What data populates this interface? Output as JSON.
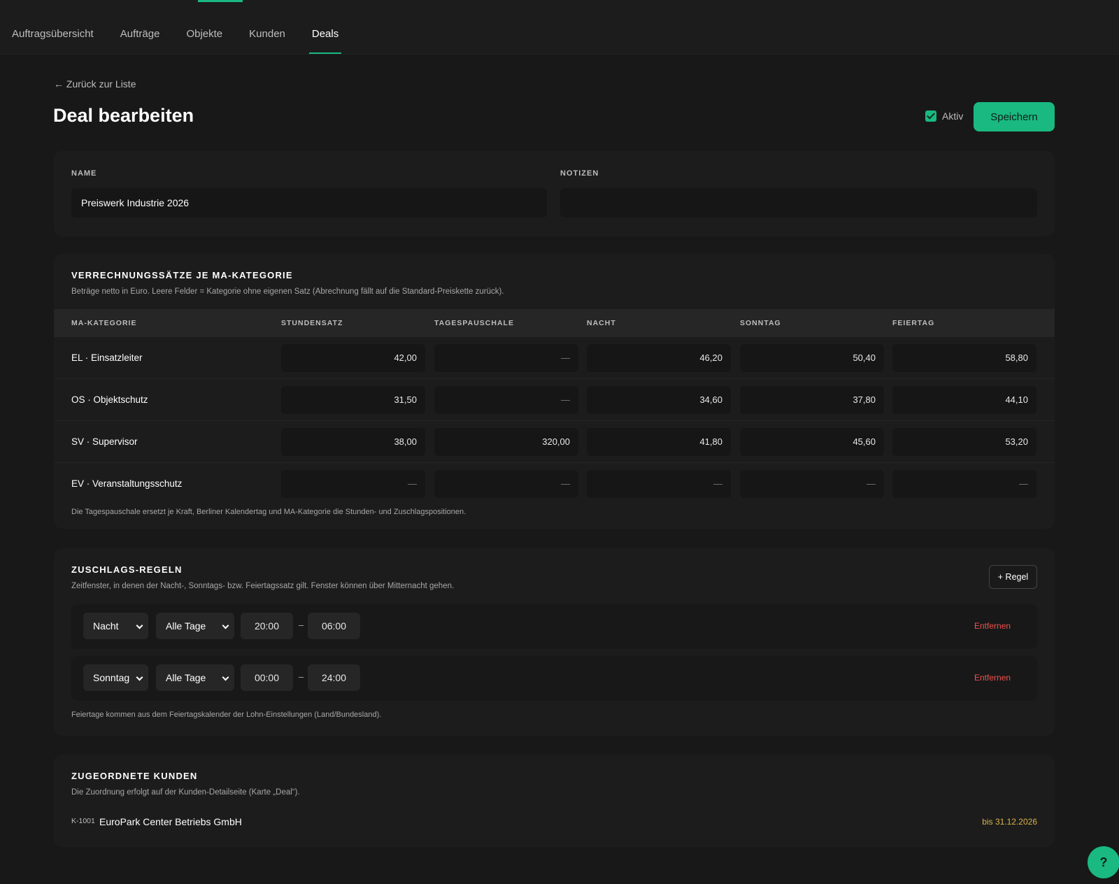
{
  "nav": {
    "items": [
      {
        "label": "Auftragsübersicht"
      },
      {
        "label": "Aufträge"
      },
      {
        "label": "Objekte"
      },
      {
        "label": "Kunden"
      },
      {
        "label": "Deals"
      }
    ],
    "active": "Deals"
  },
  "header": {
    "back_label": "← Zurück zur Liste",
    "title": "Deal bearbeiten",
    "aktiv_label": "Aktiv",
    "aktiv_checked": true,
    "save_label": "Speichern"
  },
  "details": {
    "name_label": "NAME",
    "name_value": "Preiswerk Industrie 2026",
    "notes_label": "NOTIZEN",
    "notes_value": ""
  },
  "rates": {
    "title": "VERRECHNUNGSSÄTZE JE MA-KATEGORIE",
    "subtitle": "Beträge netto in Euro. Leere Felder = Kategorie ohne eigenen Satz (Abrechnung fällt auf die Standard-Preiskette zurück).",
    "columns": [
      "MA-KATEGORIE",
      "STUNDENSATZ",
      "TAGESPAUSCHALE",
      "NACHT",
      "SONNTAG",
      "FEIERTAG"
    ],
    "rows": [
      {
        "category": "EL · Einsatzleiter",
        "values": [
          "42,00",
          "—",
          "46,20",
          "50,40",
          "58,80"
        ]
      },
      {
        "category": "OS · Objektschutz",
        "values": [
          "31,50",
          "—",
          "34,60",
          "37,80",
          "44,10"
        ]
      },
      {
        "category": "SV · Supervisor",
        "values": [
          "38,00",
          "320,00",
          "41,80",
          "45,60",
          "53,20"
        ]
      },
      {
        "category": "EV · Veranstaltungsschutz",
        "values": [
          "—",
          "—",
          "—",
          "—",
          "—"
        ]
      }
    ],
    "footnote": "Die Tagespauschale ersetzt je Kraft, Berliner Kalendertag und MA-Kategorie die Stunden- und Zuschlagspositionen."
  },
  "rules": {
    "title": "ZUSCHLAGS-REGELN",
    "subtitle": "Zeitfenster, in denen der Nacht-, Sonntags- bzw. Feiertagssatz gilt. Fenster können über Mitternacht gehen.",
    "add_label": "+ Regel",
    "items": [
      {
        "type": "Nacht",
        "days": "Alle Tage",
        "from": "20:00",
        "sep": "–",
        "to": "06:00",
        "remove_label": "Entfernen"
      },
      {
        "type": "Sonntag",
        "days": "Alle Tage",
        "from": "00:00",
        "sep": "–",
        "to": "24:00",
        "remove_label": "Entfernen"
      }
    ],
    "footnote": "Feiertage kommen aus dem Feiertagskalender der Lohn-Einstellungen (Land/Bundesland)."
  },
  "customers": {
    "title": "ZUGEORDNETE KUNDEN",
    "subtitle": "Die Zuordnung erfolgt auf der Kunden-Detailseite (Karte „Deal“).",
    "items": [
      {
        "id": "K-1001",
        "name": "EuroPark Center Betriebs GmbH",
        "until": "bis 31.12.2026"
      }
    ]
  },
  "help": {
    "label": "?"
  },
  "colors": {
    "accent": "#19b981",
    "danger": "#f0524f",
    "warning": "#d9b44a",
    "background": "#181818"
  }
}
